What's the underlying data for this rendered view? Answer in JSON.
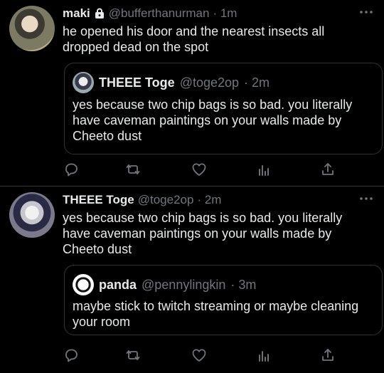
{
  "tweets": [
    {
      "name": "maki",
      "handle": "@bufferthanurman",
      "time": "· 1m",
      "protected_icon": "lock-icon",
      "text": "he opened his door and the nearest insects all dropped dead on the spot",
      "quote": {
        "name": "THEEE Toge",
        "handle": "@toge2op",
        "time": "· 2m",
        "text": "yes because two chip bags is so bad. you literally have caveman paintings on your walls made by Cheeto dust"
      }
    },
    {
      "name": "THEEE Toge",
      "handle": "@toge2op",
      "time": "· 2m",
      "text": "yes because two chip bags is so bad. you literally have caveman paintings on your walls made by Cheeto dust",
      "quote": {
        "name": "panda",
        "handle": "@pennylingkin",
        "time": "· 3m",
        "text": "maybe stick to twitch streaming or maybe cleaning your room"
      }
    }
  ],
  "action_icons": [
    "reply-icon",
    "retweet-icon",
    "like-icon",
    "analytics-icon",
    "share-icon"
  ],
  "colors": {
    "background": "#000000",
    "text": "#e7e9ea",
    "muted": "#71767b",
    "border": "#2f3336"
  }
}
